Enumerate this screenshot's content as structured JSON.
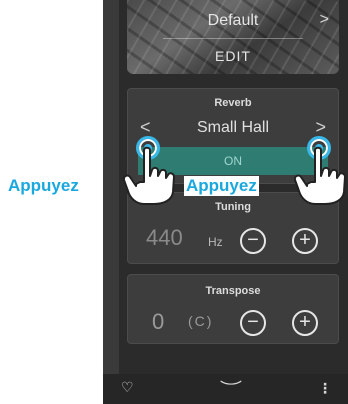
{
  "banner": {
    "preset": "Default",
    "edit": "EDIT",
    "next_icon": "chevron-right-icon"
  },
  "reverb": {
    "title": "Reverb",
    "value": "Small Hall",
    "toggle": "ON",
    "prev_symbol": "<",
    "next_symbol": ">"
  },
  "tuning": {
    "title": "Tuning",
    "value": "440",
    "unit": "Hz",
    "minus": "−",
    "plus": "+"
  },
  "transpose": {
    "title": "Transpose",
    "value": "0",
    "key": "(C)",
    "minus": "−",
    "plus": "+"
  },
  "bottom_bar": {
    "favorite_icon": "heart-icon",
    "collapse_icon": "chevron-down-icon",
    "menu_icon": "kebab-menu-icon"
  },
  "annotations": {
    "left_label": "Appuyez",
    "right_label": "Appuyez",
    "accent_color": "#1aa8df"
  }
}
